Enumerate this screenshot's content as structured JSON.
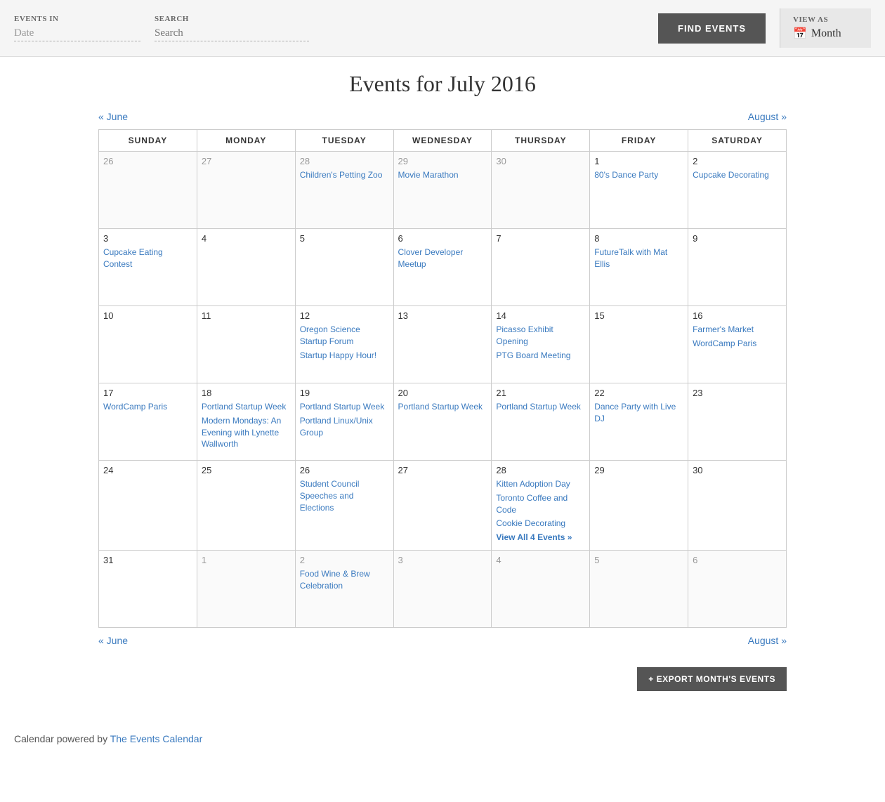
{
  "topbar": {
    "events_in_label": "EVENTS IN",
    "events_in_value": "Date",
    "search_label": "SEARCH",
    "search_placeholder": "Search",
    "find_events_label": "FIND EVENTS",
    "view_as_label": "VIEW AS",
    "view_as_value": "Month"
  },
  "page": {
    "title": "Events for July 2016",
    "prev_label": "« June",
    "next_label": "August »",
    "prev_url": "#",
    "next_url": "#"
  },
  "calendar": {
    "headers": [
      "SUNDAY",
      "MONDAY",
      "TUESDAY",
      "WEDNESDAY",
      "THURSDAY",
      "FRIDAY",
      "SATURDAY"
    ],
    "weeks": [
      [
        {
          "day": "26",
          "current": false,
          "events": []
        },
        {
          "day": "27",
          "current": false,
          "events": []
        },
        {
          "day": "28",
          "current": false,
          "events": [
            {
              "label": "Children's Petting Zoo",
              "url": "#"
            }
          ]
        },
        {
          "day": "29",
          "current": false,
          "events": [
            {
              "label": "Movie Marathon",
              "url": "#"
            }
          ]
        },
        {
          "day": "30",
          "current": false,
          "events": []
        },
        {
          "day": "1",
          "current": true,
          "events": [
            {
              "label": "80's Dance Party",
              "url": "#"
            }
          ]
        },
        {
          "day": "2",
          "current": true,
          "events": [
            {
              "label": "Cupcake Decorating",
              "url": "#"
            }
          ]
        }
      ],
      [
        {
          "day": "3",
          "current": true,
          "events": [
            {
              "label": "Cupcake Eating Contest",
              "url": "#"
            }
          ]
        },
        {
          "day": "4",
          "current": true,
          "events": []
        },
        {
          "day": "5",
          "current": true,
          "events": []
        },
        {
          "day": "6",
          "current": true,
          "events": [
            {
              "label": "Clover Developer Meetup",
              "url": "#"
            }
          ]
        },
        {
          "day": "7",
          "current": true,
          "events": []
        },
        {
          "day": "8",
          "current": true,
          "events": [
            {
              "label": "FutureTalk with Mat Ellis",
              "url": "#"
            }
          ]
        },
        {
          "day": "9",
          "current": true,
          "events": []
        }
      ],
      [
        {
          "day": "10",
          "current": true,
          "events": []
        },
        {
          "day": "11",
          "current": true,
          "events": []
        },
        {
          "day": "12",
          "current": true,
          "events": [
            {
              "label": "Oregon Science Startup Forum",
              "url": "#"
            },
            {
              "label": "Startup Happy Hour!",
              "url": "#"
            }
          ]
        },
        {
          "day": "13",
          "current": true,
          "events": []
        },
        {
          "day": "14",
          "current": true,
          "events": [
            {
              "label": "Picasso Exhibit Opening",
              "url": "#"
            },
            {
              "label": "PTG Board Meeting",
              "url": "#"
            }
          ]
        },
        {
          "day": "15",
          "current": true,
          "events": []
        },
        {
          "day": "16",
          "current": true,
          "events": [
            {
              "label": "Farmer's Market",
              "url": "#"
            },
            {
              "label": "WordCamp Paris",
              "url": "#"
            }
          ]
        }
      ],
      [
        {
          "day": "17",
          "current": true,
          "events": [
            {
              "label": "WordCamp Paris",
              "url": "#"
            }
          ]
        },
        {
          "day": "18",
          "current": true,
          "events": [
            {
              "label": "Portland Startup Week",
              "url": "#"
            },
            {
              "label": "Modern Mondays: An Evening with Lynette Wallworth",
              "url": "#"
            }
          ]
        },
        {
          "day": "19",
          "current": true,
          "events": [
            {
              "label": "Portland Startup Week",
              "url": "#"
            },
            {
              "label": "Portland Linux/Unix Group",
              "url": "#"
            }
          ]
        },
        {
          "day": "20",
          "current": true,
          "events": [
            {
              "label": "Portland Startup Week",
              "url": "#"
            }
          ]
        },
        {
          "day": "21",
          "current": true,
          "events": [
            {
              "label": "Portland Startup Week",
              "url": "#"
            }
          ]
        },
        {
          "day": "22",
          "current": true,
          "events": [
            {
              "label": "Dance Party with Live DJ",
              "url": "#"
            }
          ]
        },
        {
          "day": "23",
          "current": true,
          "events": []
        }
      ],
      [
        {
          "day": "24",
          "current": true,
          "events": []
        },
        {
          "day": "25",
          "current": true,
          "events": []
        },
        {
          "day": "26",
          "current": true,
          "events": [
            {
              "label": "Student Council Speeches and Elections",
              "url": "#"
            }
          ]
        },
        {
          "day": "27",
          "current": true,
          "events": []
        },
        {
          "day": "28",
          "current": true,
          "events": [
            {
              "label": "Kitten Adoption Day",
              "url": "#"
            },
            {
              "label": "Toronto Coffee and Code",
              "url": "#"
            },
            {
              "label": "Cookie Decorating",
              "url": "#"
            },
            {
              "label": "View All 4 Events »",
              "url": "#",
              "view_all": true
            }
          ]
        },
        {
          "day": "29",
          "current": true,
          "events": []
        },
        {
          "day": "30",
          "current": true,
          "events": []
        }
      ],
      [
        {
          "day": "31",
          "current": true,
          "events": []
        },
        {
          "day": "1",
          "current": false,
          "events": []
        },
        {
          "day": "2",
          "current": false,
          "events": [
            {
              "label": "Food Wine & Brew Celebration",
              "url": "#"
            }
          ]
        },
        {
          "day": "3",
          "current": false,
          "events": []
        },
        {
          "day": "4",
          "current": false,
          "events": []
        },
        {
          "day": "5",
          "current": false,
          "events": []
        },
        {
          "day": "6",
          "current": false,
          "events": []
        }
      ]
    ]
  },
  "export": {
    "label": "+ EXPORT MONTH'S EVENTS"
  },
  "footer": {
    "text": "Calendar powered by ",
    "link_label": "The Events Calendar",
    "link_url": "#"
  }
}
